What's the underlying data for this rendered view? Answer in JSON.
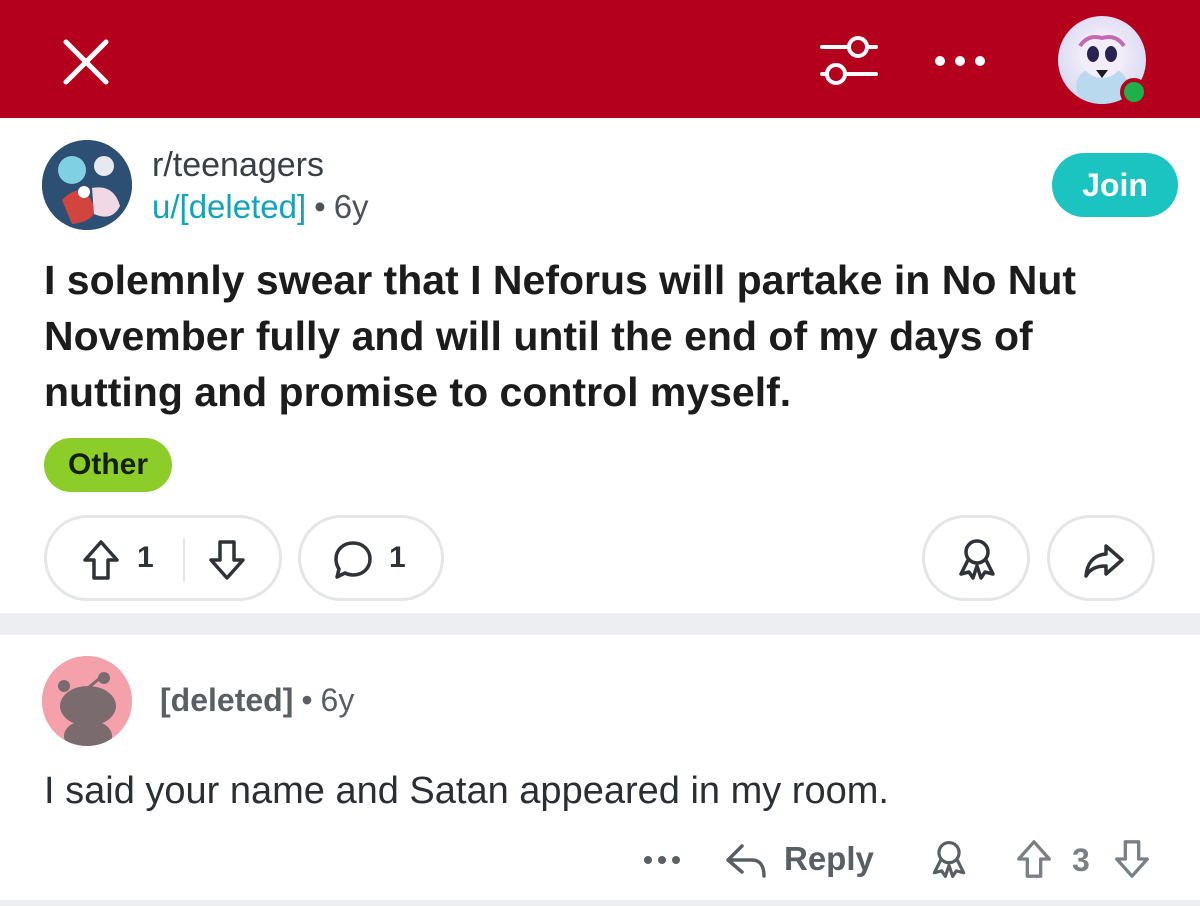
{
  "header": {
    "close_icon": "close-icon",
    "filter_icon": "sort-filter-icon",
    "more_icon": "more-horizontal-icon",
    "online_color": "#1db04b",
    "bar_color": "#b5001d"
  },
  "post": {
    "subreddit": "r/teenagers",
    "author": "u/[deleted]",
    "separator": "•",
    "age": "6y",
    "join_label": "Join",
    "title": "I solemnly swear that I Neforus will partake in No Nut November fully and will until the end of my days of nutting and promise to control myself.",
    "flair": "Other",
    "flair_color": "#8ccd2a",
    "upvotes": "1",
    "comments": "1"
  },
  "comment": {
    "author": "[deleted]",
    "separator": "•",
    "age": "6y",
    "body": "I said your name and Satan appeared in my room.",
    "reply_label": "Reply",
    "score": "3"
  }
}
